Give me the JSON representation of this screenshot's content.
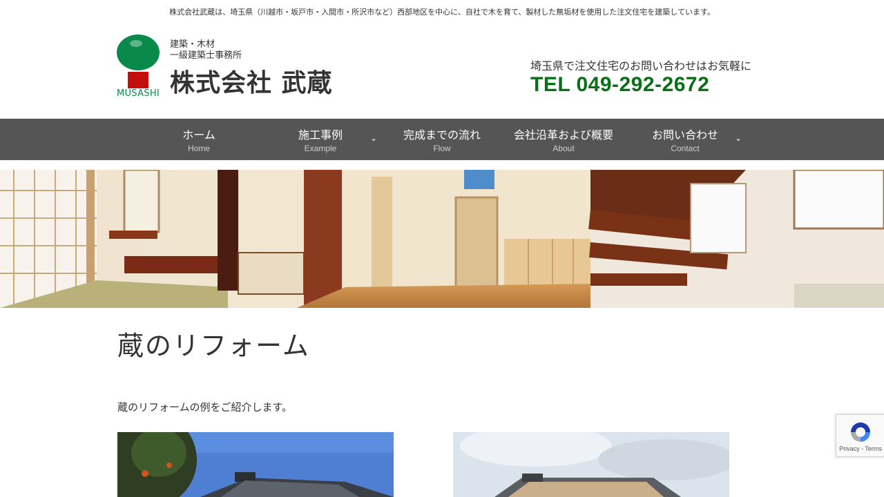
{
  "header": {
    "tagline": "株式会社武蔵は、埼玉県（川越市・坂戸市・入間市・所沢市など）西部地区を中心に、自社で木を育て、製材した無垢材を使用した注文住宅を建築しています。",
    "logo_text": "MUSASHI",
    "brand_line1": "建築・木材",
    "brand_line2": "一級建築士事務所",
    "brand_name": "株式会社 武蔵",
    "contact_prompt": "埼玉県で注文住宅のお問い合わせはお気軽に",
    "tel": "TEL 049-292-2672"
  },
  "nav": {
    "items": [
      {
        "jp": "ホーム",
        "en": "Home"
      },
      {
        "jp": "施工事例",
        "en": "Example",
        "caret": "⌄"
      },
      {
        "jp": "完成までの流れ",
        "en": "Flow"
      },
      {
        "jp": "会社沿革および概要",
        "en": "About"
      },
      {
        "jp": "お問い合わせ",
        "en": "Contact",
        "caret": "⌄"
      }
    ]
  },
  "main": {
    "title": "蔵のリフォーム",
    "intro": "蔵のリフォームの例をご紹介します。"
  },
  "recaptcha": {
    "links": "Privacy - Terms"
  },
  "colors": {
    "nav_bg": "#555555",
    "tel": "#0a6f16",
    "logo_green": "#0a8a4a",
    "logo_red": "#c40f0f"
  },
  "icons": [
    "musashi-logo-icon",
    "chevron-down-icon",
    "recaptcha-icon"
  ]
}
